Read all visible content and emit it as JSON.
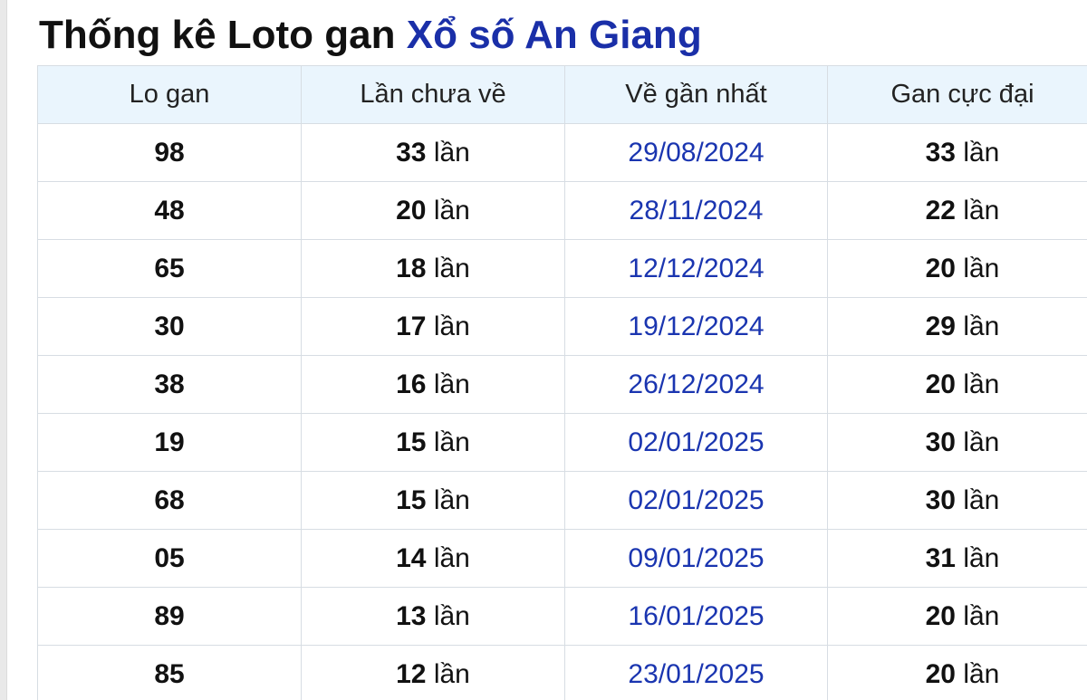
{
  "title": {
    "prefix": "Thống kê Loto gan",
    "link": "Xổ số An Giang"
  },
  "table": {
    "headers": [
      "Lo gan",
      "Lần chưa về",
      "Về gần nhất",
      "Gan cực đại"
    ],
    "unit": "lần",
    "rows": [
      {
        "number": "98",
        "missed": "33",
        "last_seen": "29/08/2024",
        "max_gap": "33"
      },
      {
        "number": "48",
        "missed": "20",
        "last_seen": "28/11/2024",
        "max_gap": "22"
      },
      {
        "number": "65",
        "missed": "18",
        "last_seen": "12/12/2024",
        "max_gap": "20"
      },
      {
        "number": "30",
        "missed": "17",
        "last_seen": "19/12/2024",
        "max_gap": "29"
      },
      {
        "number": "38",
        "missed": "16",
        "last_seen": "26/12/2024",
        "max_gap": "20"
      },
      {
        "number": "19",
        "missed": "15",
        "last_seen": "02/01/2025",
        "max_gap": "30"
      },
      {
        "number": "68",
        "missed": "15",
        "last_seen": "02/01/2025",
        "max_gap": "30"
      },
      {
        "number": "05",
        "missed": "14",
        "last_seen": "09/01/2025",
        "max_gap": "31"
      },
      {
        "number": "89",
        "missed": "13",
        "last_seen": "16/01/2025",
        "max_gap": "20"
      },
      {
        "number": "85",
        "missed": "12",
        "last_seen": "23/01/2025",
        "max_gap": "20"
      }
    ]
  },
  "colors": {
    "title_link": "#1a2fa8",
    "date_text": "#1a35b0",
    "header_bg": "#eaf5fd",
    "border": "#d7dde3"
  }
}
